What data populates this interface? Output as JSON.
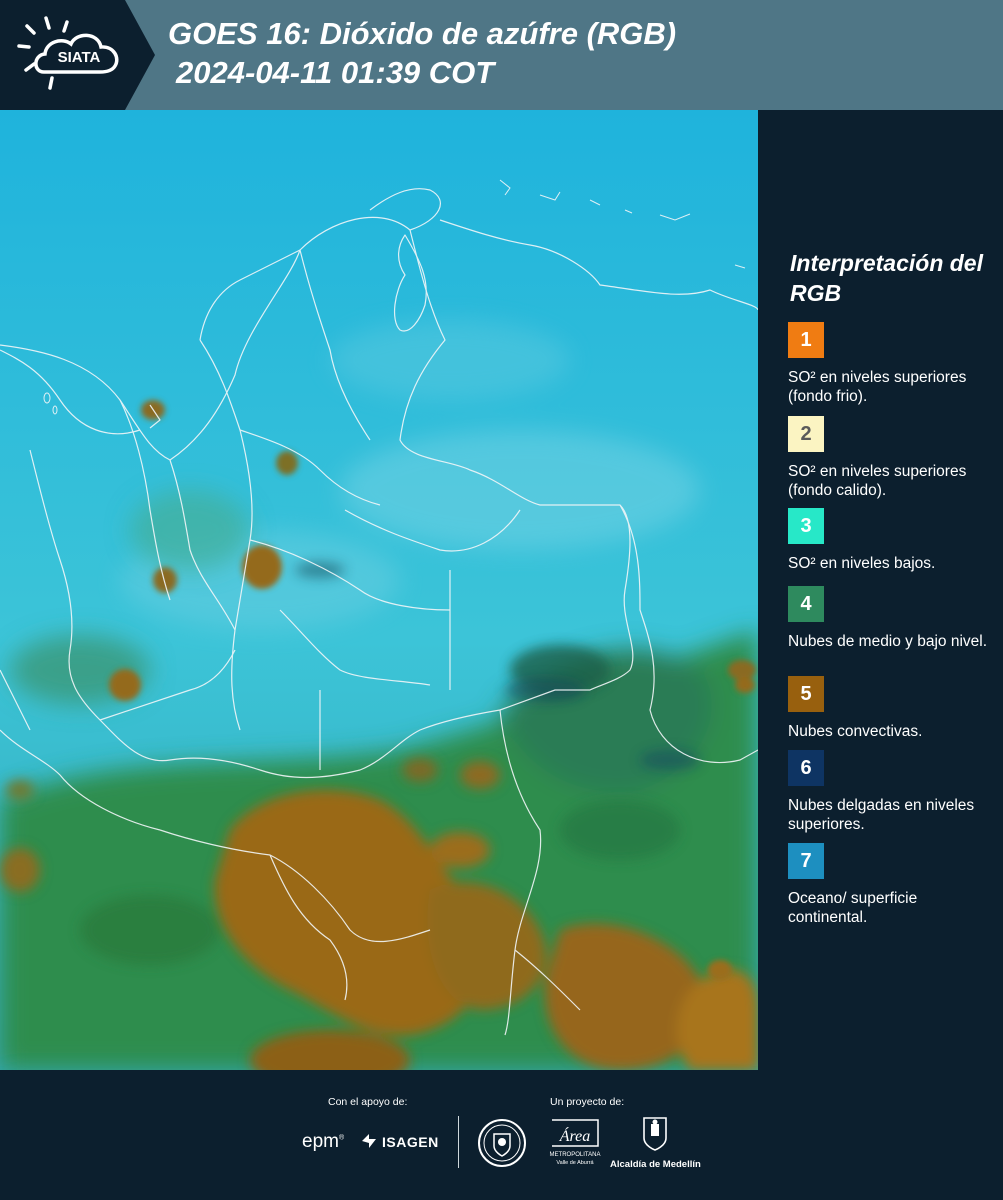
{
  "header": {
    "logo_text": "SIATA",
    "title_line1": "GOES 16: Dióxido de azúfre (RGB)",
    "title_line2": "2024-04-11 01:39 COT"
  },
  "legend": {
    "title": "Interpretación del RGB",
    "items": [
      {
        "num": "1",
        "color": "#f07c12",
        "text": "SO² en niveles superiores (fondo frio)."
      },
      {
        "num": "2",
        "color": "#fbf4c2",
        "text": "SO² en niveles superiores (fondo calido)."
      },
      {
        "num": "3",
        "color": "#27e8c8",
        "text": "SO² en niveles bajos."
      },
      {
        "num": "4",
        "color": "#2e8a5e",
        "text": "Nubes de medio y bajo nivel."
      },
      {
        "num": "5",
        "color": "#98600e",
        "text": "Nubes convectivas."
      },
      {
        "num": "6",
        "color": "#0e3463",
        "text": "Nubes delgadas en niveles superiores."
      },
      {
        "num": "7",
        "color": "#1d8fc0",
        "text": "Oceano/ superficie continental."
      }
    ]
  },
  "footer": {
    "support_label": "Con el apoyo de:",
    "project_label": "Un proyecto de:",
    "epm": "epm",
    "isagen": "ISAGEN",
    "area_text": "Área",
    "area_sub1": "METROPOLITANA",
    "area_sub2": "Valle de Aburrá",
    "alcaldia": "Alcaldía de Medellín"
  },
  "colors": {
    "header_bg": "#4f7686",
    "panel_bg": "#0c1f2e",
    "sky_cyan": "#3cbad8",
    "convective": "#98600e",
    "vegetation": "#2e8a5e"
  }
}
